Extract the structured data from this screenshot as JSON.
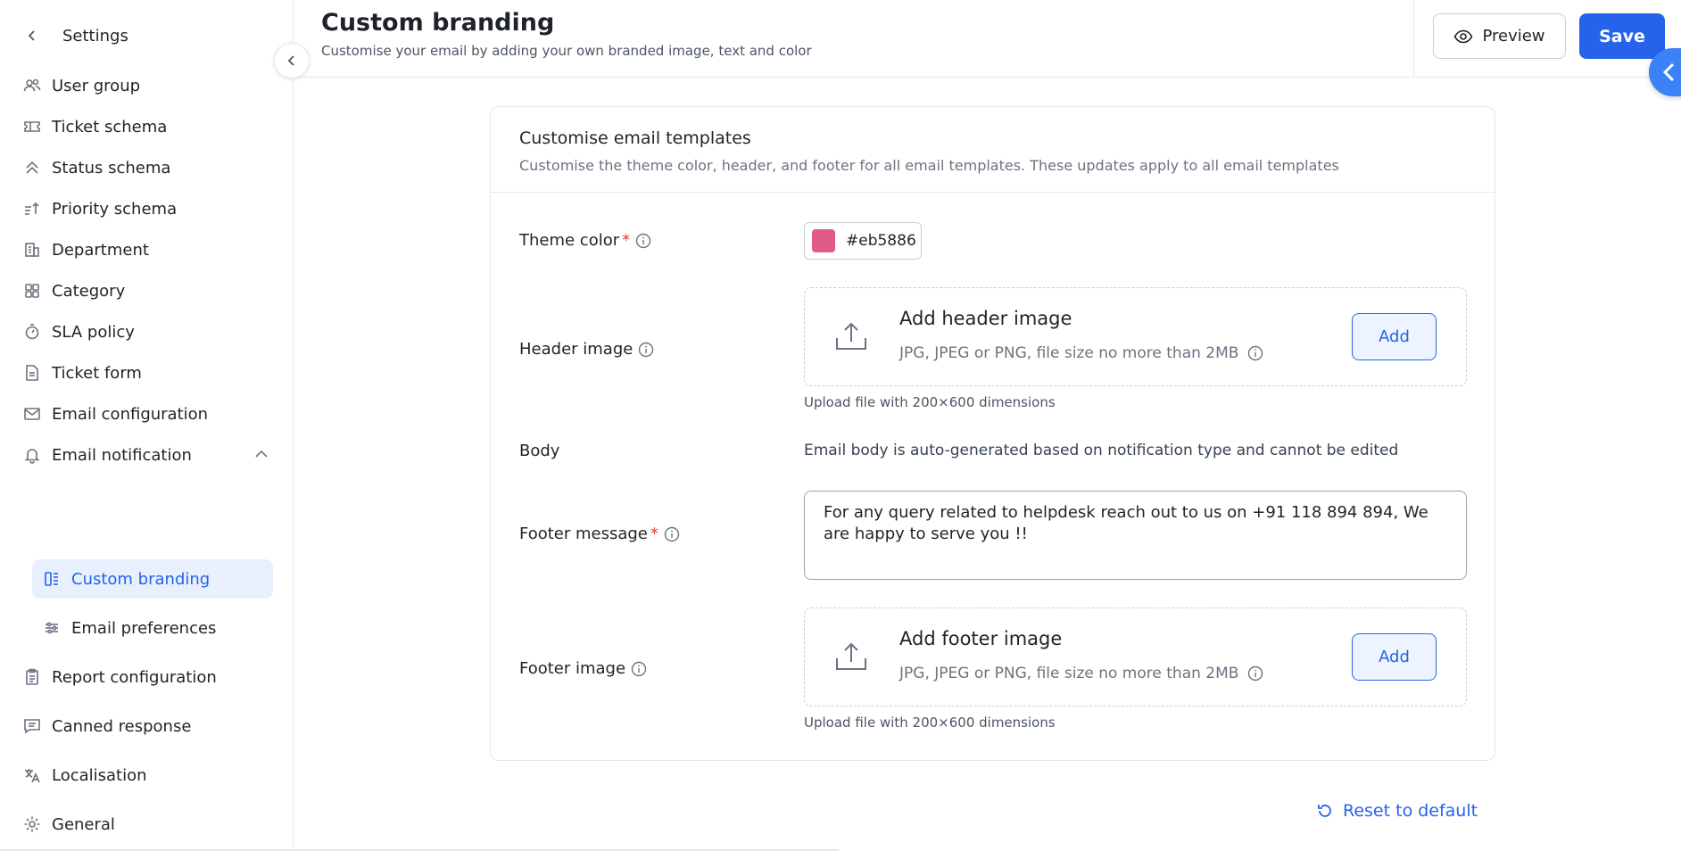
{
  "sidebar": {
    "title": "Settings",
    "items": [
      {
        "label": "User group",
        "icon": "users-icon"
      },
      {
        "label": "Ticket schema",
        "icon": "ticket-icon"
      },
      {
        "label": "Status schema",
        "icon": "chevrons-up-icon"
      },
      {
        "label": "Priority schema",
        "icon": "sort-priority-icon"
      },
      {
        "label": "Department",
        "icon": "building-icon"
      },
      {
        "label": "Category",
        "icon": "grid-icon"
      },
      {
        "label": "SLA policy",
        "icon": "stopwatch-icon"
      },
      {
        "label": "Ticket form",
        "icon": "document-icon"
      },
      {
        "label": "Email configuration",
        "icon": "mail-icon"
      },
      {
        "label": "Email notification",
        "icon": "bell-icon"
      },
      {
        "label": "Custom branding",
        "icon": "branding-icon"
      },
      {
        "label": "Email preferences",
        "icon": "sliders-icon"
      },
      {
        "label": "Report configuration",
        "icon": "clipboard-icon"
      },
      {
        "label": "Canned response",
        "icon": "message-icon"
      },
      {
        "label": "Localisation",
        "icon": "translate-icon"
      },
      {
        "label": "General",
        "icon": "gear-icon"
      }
    ]
  },
  "header": {
    "title": "Custom branding",
    "subtitle": "Customise your email by adding your own branded image, text and color",
    "preview_label": "Preview",
    "save_label": "Save"
  },
  "card": {
    "title": "Customise email templates",
    "subtitle": "Customise the theme color, header, and footer for all email templates. These updates apply to all email templates"
  },
  "theme_color": {
    "label": "Theme color",
    "value": "#eb5886",
    "swatch_color": "#e05a86"
  },
  "header_image": {
    "label": "Header image",
    "title": "Add header image",
    "hint": "JPG, JPEG or PNG, file size no more than 2MB",
    "add_label": "Add",
    "note": "Upload file with 200×600 dimensions"
  },
  "body": {
    "label": "Body",
    "note": "Email body is auto-generated based on notification type and cannot be edited"
  },
  "footer_message": {
    "label": "Footer message",
    "value": "For any query related to helpdesk reach out to us on +91 118 894 894, We are happy to serve you !!"
  },
  "footer_image": {
    "label": "Footer image",
    "title": "Add footer image",
    "hint": "JPG, JPEG or PNG, file size no more than 2MB",
    "add_label": "Add",
    "note": "Upload file with 200×600 dimensions"
  },
  "reset_label": "Reset to default",
  "colors": {
    "accent": "#2563eb",
    "required": "#e53935",
    "active_bg": "#e8f0fe"
  }
}
